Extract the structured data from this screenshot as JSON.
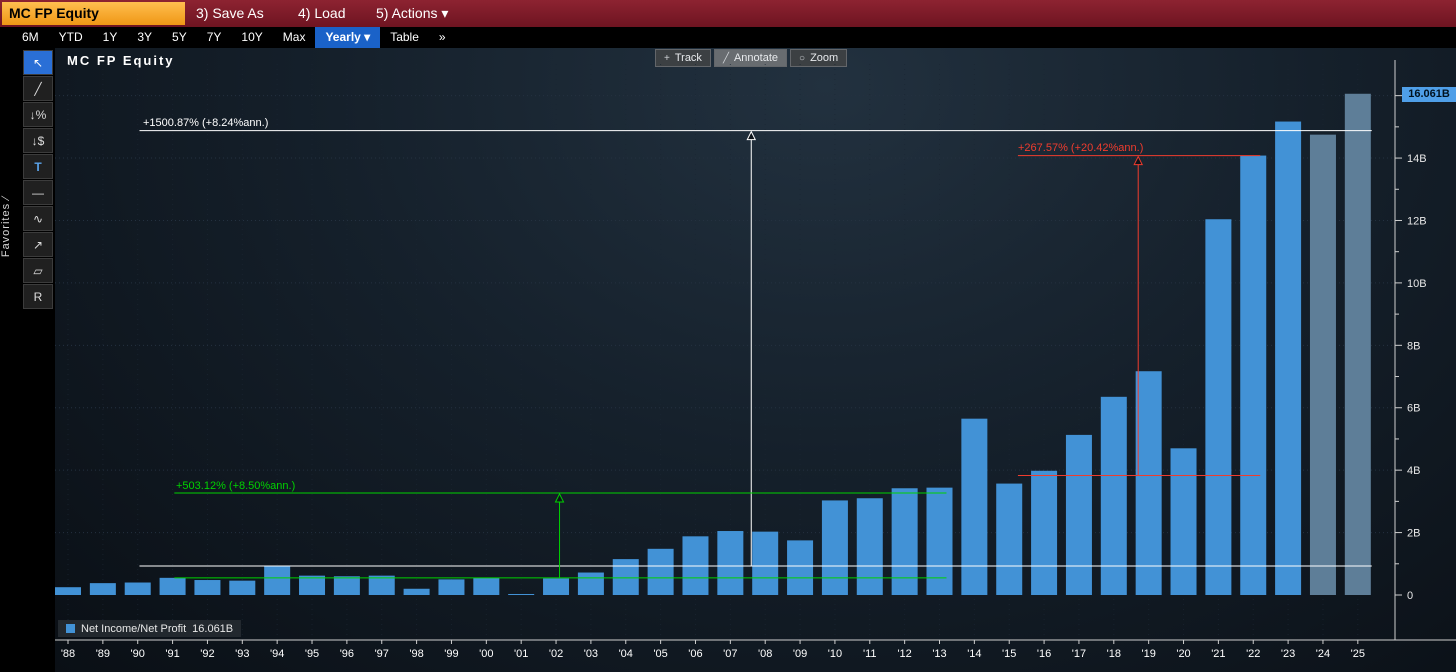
{
  "window": {
    "ticker": "MC FP Equity",
    "menu_items": [
      {
        "label": "3) Save As"
      },
      {
        "label": "4) Load"
      },
      {
        "label": "5) Actions ▾"
      }
    ]
  },
  "tabbar": {
    "tabs": [
      "6M",
      "YTD",
      "1Y",
      "3Y",
      "5Y",
      "7Y",
      "10Y",
      "Max"
    ],
    "active_tab": "Yearly ▾",
    "table_tab": "Table",
    "overflow": "»"
  },
  "sidebar": {
    "slash": "∕",
    "favorites_label": "Favorites",
    "tools": [
      {
        "name": "cursor-tool",
        "glyph": "↖",
        "active": true
      },
      {
        "name": "pencil-tool",
        "glyph": "╱"
      },
      {
        "name": "percent-change-tool",
        "glyph": "↓%"
      },
      {
        "name": "price-change-tool",
        "glyph": "↓$"
      },
      {
        "name": "text-tool",
        "glyph": "T"
      },
      {
        "name": "horizontal-line-tool",
        "glyph": "—"
      },
      {
        "name": "trendline-tool",
        "glyph": "∿"
      },
      {
        "name": "arrow-tool",
        "glyph": "↗"
      },
      {
        "name": "polygon-tool",
        "glyph": "▱"
      },
      {
        "name": "regression-tool",
        "glyph": "R"
      }
    ]
  },
  "chart_header": {
    "title": "MC FP Equity",
    "buttons": [
      {
        "label": "Track",
        "icon": "+"
      },
      {
        "label": "Annotate",
        "icon": "╱",
        "active": true
      },
      {
        "label": "Zoom",
        "icon": "○"
      }
    ]
  },
  "legend": {
    "label": "Net Income/Net Profit",
    "value": "16.061B",
    "swatch_color": "#4292d6"
  },
  "axis": {
    "last_value_badge": "16.061B"
  },
  "chart_data": {
    "type": "bar",
    "title": "MC FP Equity — Net Income/Net Profit (Yearly)",
    "categories": [
      "'88",
      "'89",
      "'90",
      "'91",
      "'92",
      "'93",
      "'94",
      "'95",
      "'96",
      "'97",
      "'98",
      "'99",
      "'00",
      "'01",
      "'02",
      "'03",
      "'04",
      "'05",
      "'06",
      "'07",
      "'08",
      "'09",
      "'10",
      "'11",
      "'12",
      "'13",
      "'14",
      "'15",
      "'16",
      "'17",
      "'18",
      "'19",
      "'20",
      "'21",
      "'22",
      "'23",
      "'24",
      "'25"
    ],
    "values": [
      0.25,
      0.38,
      0.4,
      0.55,
      0.48,
      0.46,
      0.92,
      0.62,
      0.6,
      0.62,
      0.2,
      0.5,
      0.55,
      0.01,
      0.53,
      0.72,
      1.15,
      1.48,
      1.88,
      2.05,
      2.03,
      1.75,
      3.03,
      3.1,
      3.42,
      3.44,
      5.65,
      3.57,
      3.98,
      5.13,
      6.35,
      7.17,
      4.7,
      12.04,
      14.08,
      15.17,
      14.75,
      16.06
    ],
    "estimate_from_index": 36,
    "estimate_years": [
      "'24",
      "'25"
    ],
    "bar_color": "#4292d6",
    "estimate_bar_color": "#5e7e98",
    "ylim": [
      0,
      16.8
    ],
    "ytick_labels": [
      "0",
      "2B",
      "4B",
      "6B",
      "8B",
      "10B",
      "12B",
      "14B"
    ],
    "grid": true,
    "legend_position": "bottom-left",
    "annotations": [
      {
        "id": "long-term-return",
        "color": "#ffffff",
        "label": "+1500.87% (+8.24%ann.)",
        "base_value": 0.93,
        "top_value": 14.88,
        "x_from_year": 1990.05,
        "x_to_year": 2025.4,
        "arrow_year": 2007.6
      },
      {
        "id": "mid-term-return",
        "color": "#00d200",
        "label": "+503.12% (+8.50%ann.)",
        "base_value": 0.55,
        "top_value": 3.27,
        "x_from_year": 1991.05,
        "x_to_year": 2013.2,
        "arrow_year": 2002.1
      },
      {
        "id": "recent-return",
        "color": "#f03c2e",
        "label": "+267.57% (+20.42%ann.)",
        "base_value": 3.83,
        "top_value": 14.08,
        "x_from_year": 2015.25,
        "x_to_year": 2022.2,
        "arrow_year": 2018.7
      }
    ]
  }
}
